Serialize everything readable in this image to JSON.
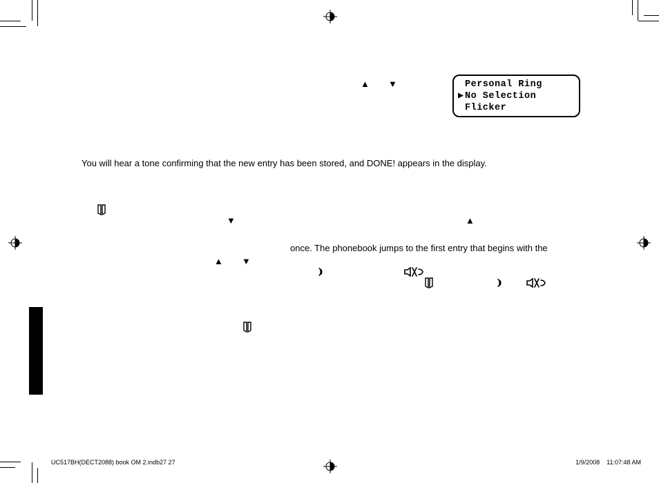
{
  "lcd": {
    "line1": "Personal Ring",
    "line2_prefix": "▶",
    "line2": "No Selection",
    "line3": "Flicker"
  },
  "body": {
    "para1": "You will hear a tone confirming that the new entry has been stored, and DONE! appears in the display.",
    "para2": "once. The phonebook jumps to the first entry that begins with the"
  },
  "footer": {
    "left": "UC517BH(DECT2088) book OM 2.indb27   27",
    "date": "1/9/2008",
    "time": "11:07:48 AM"
  }
}
